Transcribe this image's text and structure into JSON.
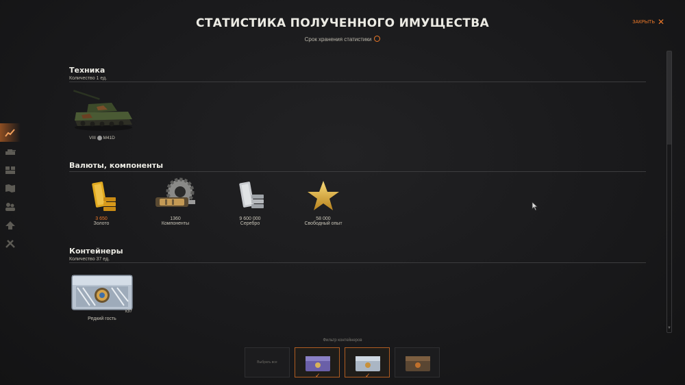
{
  "header": {
    "title": "СТАТИСТИКА ПОЛУЧЕННОГО ИМУЩЕСТВА",
    "subtitle": "Срок хранения статистики",
    "close_label": "закрыть"
  },
  "side_nav": {
    "icons": [
      "stats-icon",
      "tank-icon",
      "hangar-icon",
      "map-icon",
      "crew-icon",
      "upgrade-icon",
      "tools-icon"
    ],
    "active_index": 0
  },
  "sections": {
    "vehicles": {
      "title": "Техника",
      "count": "Количество 1 ед.",
      "items": [
        {
          "tier": "VIII",
          "name": "M41D"
        }
      ]
    },
    "currencies": {
      "title": "Валюты, компоненты",
      "items": [
        {
          "value": "3 650",
          "label": "Золото",
          "icon": "gold-bars-icon"
        },
        {
          "value": "1360",
          "label": "Компоненты",
          "icon": "components-gear-icon"
        },
        {
          "value": "9 600 000",
          "label": "Серебро",
          "icon": "silver-bars-icon"
        },
        {
          "value": "58 000",
          "label": "Свободный опыт",
          "icon": "free-xp-star-icon"
        }
      ]
    },
    "containers": {
      "title": "Контейнеры",
      "count": "Количество 37 ед.",
      "items": [
        {
          "name": "Редкий гость",
          "quantity": "x37"
        }
      ]
    }
  },
  "filter": {
    "label": "Фильтр контейнеров",
    "select_all": "Выбрать все",
    "options": [
      {
        "icon": "purple-container-icon",
        "selected": true
      },
      {
        "icon": "silver-container-icon",
        "selected": true
      },
      {
        "icon": "bronze-container-icon",
        "selected": false
      }
    ]
  },
  "colors": {
    "accent": "#f07a29",
    "background": "#1a1a1c",
    "gold_text": "#f07a29"
  }
}
